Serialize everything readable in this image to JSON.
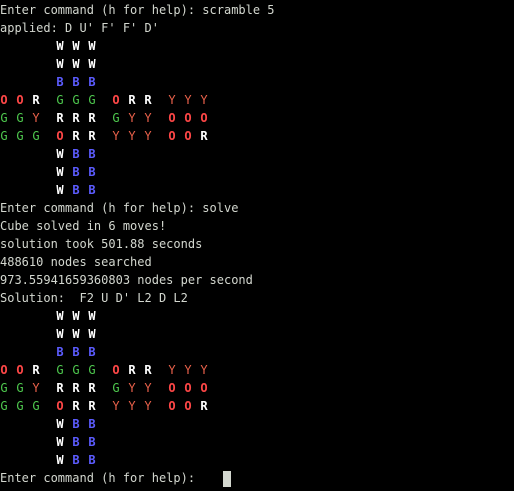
{
  "terminal": {
    "background": "#000000",
    "text_color": "#d3d7cf",
    "colors": {
      "W": "#ffffff",
      "B": "#5c5cff",
      "O": "#ff4747",
      "R": "#ffffff",
      "G": "#4ec94e",
      "Y": "#e8604a"
    },
    "lines": [
      "Enter command (h for help): scramble 5",
      "applied: D U' F' F' D'",
      "Enter command (h for help): solve",
      "Cube solved in 6 moves!",
      "solution took 501.88 seconds",
      "488610 nodes searched",
      "973.55941659360803 nodes per second",
      "Solution:  F2 U D' L2 D L2"
    ],
    "prompt": "Enter command (h for help): ",
    "cube_before": [
      "       W W W",
      "       W W W",
      "       B B B",
      "O O R  G G G  O R R  Y Y Y",
      "G G Y  R R R  G Y Y  O O O",
      "G G G  O R R  Y Y Y  O O R",
      "       W B B",
      "       W B B",
      "       W B B"
    ],
    "cube_after": [
      "       W W W",
      "       W W W",
      "       B B B",
      "O O R  G G G  O R R  Y Y Y",
      "G G Y  R R R  G Y Y  O O O",
      "G G G  O R R  Y Y Y  O O R",
      "       W B B",
      "       W B B",
      "       W B B"
    ]
  }
}
